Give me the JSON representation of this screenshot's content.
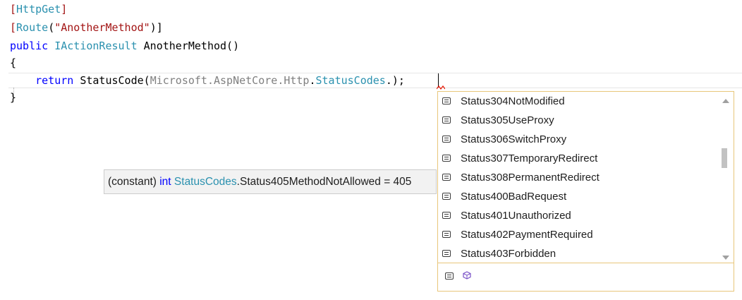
{
  "code": {
    "line1": {
      "open": "[",
      "attr": "HttpGet",
      "close": "]"
    },
    "line2": {
      "open": "[",
      "attr": "Route",
      "paren_open": "(",
      "string": "\"AnotherMethod\"",
      "paren_close": ")]"
    },
    "line3": {
      "kw": "public",
      "type": "IActionResult",
      "rest": " AnotherMethod()"
    },
    "line4": {
      "text": "{"
    },
    "line5": {
      "kw": "return",
      "call": " StatusCode(",
      "ns1": "Microsoft",
      "dot1": ".",
      "ns2": "AspNetCore",
      "dot2": ".",
      "ns3": "Http",
      "dot3": ".",
      "cls": "StatusCodes",
      "dot4": ".",
      "end": ");"
    },
    "line6": {
      "text": "}"
    }
  },
  "completion": {
    "items": [
      {
        "label": "Status304NotModified",
        "icon": "constant-field-icon"
      },
      {
        "label": "Status305UseProxy",
        "icon": "constant-field-icon"
      },
      {
        "label": "Status306SwitchProxy",
        "icon": "constant-field-icon"
      },
      {
        "label": "Status307TemporaryRedirect",
        "icon": "constant-field-icon"
      },
      {
        "label": "Status308PermanentRedirect",
        "icon": "constant-field-icon"
      },
      {
        "label": "Status400BadRequest",
        "icon": "constant-field-icon"
      },
      {
        "label": "Status401Unauthorized",
        "icon": "constant-field-icon"
      },
      {
        "label": "Status402PaymentRequired",
        "icon": "constant-field-icon"
      },
      {
        "label": "Status403Forbidden",
        "icon": "constant-field-icon"
      }
    ],
    "filters": [
      "constant-filter-icon",
      "class-filter-icon"
    ]
  },
  "tooltip": {
    "prefix": "(constant) ",
    "type_kw": "int",
    "space": " ",
    "class_name": "StatusCodes",
    "member": ".Status405MethodNotAllowed = 405"
  },
  "colors": {
    "keyword": "#0000ff",
    "type": "#2b91af",
    "string": "#a31515",
    "gray": "#808080",
    "popup_border": "#e8c67a"
  }
}
